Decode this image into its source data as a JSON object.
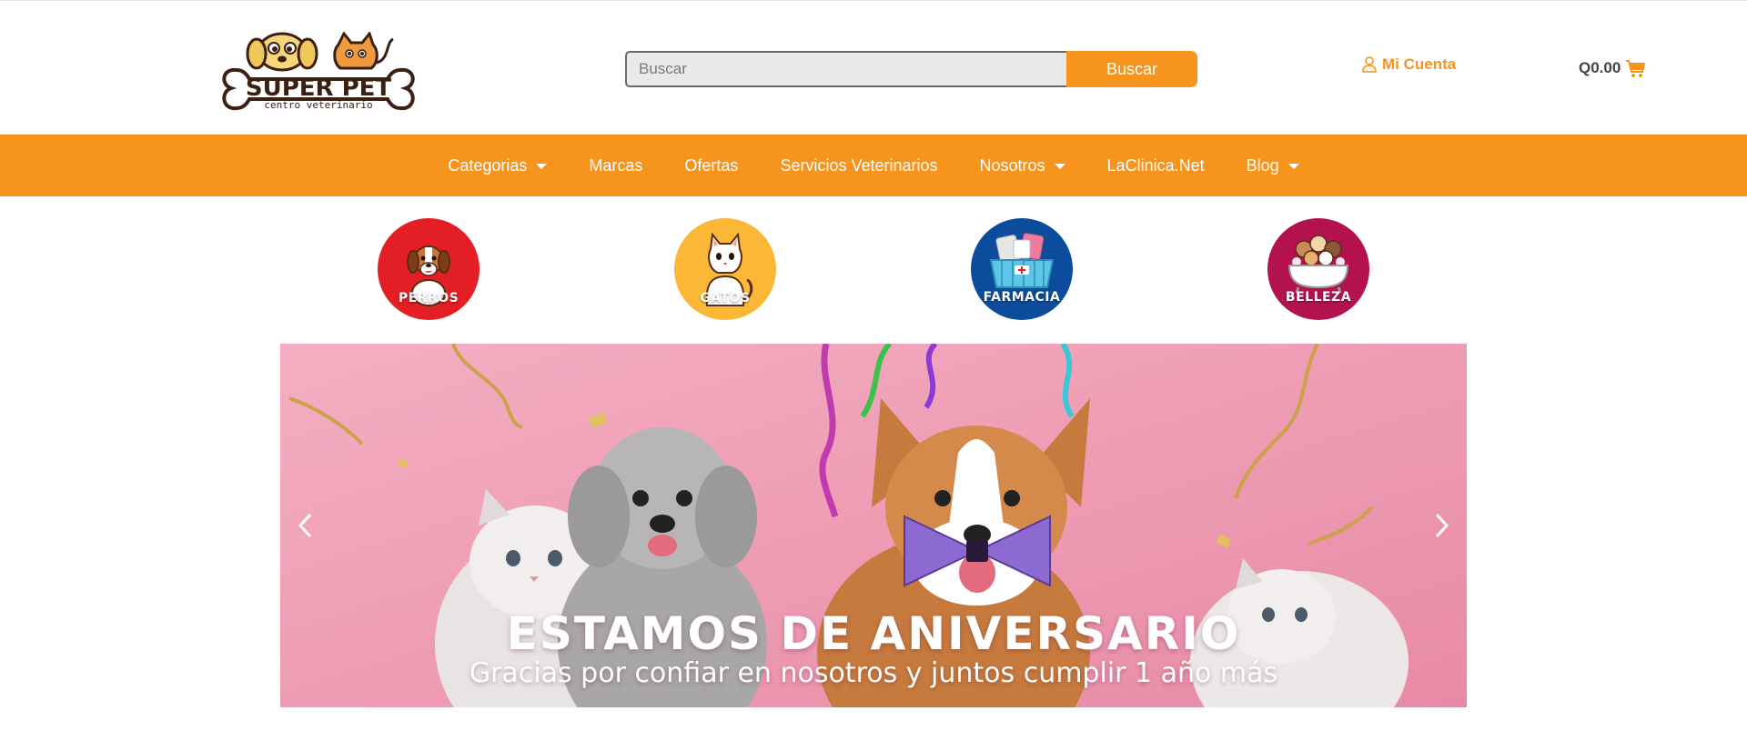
{
  "header": {
    "logo": {
      "brand": "SUPER PET",
      "tagline": "centro veterinario"
    },
    "search": {
      "placeholder": "Buscar",
      "button_label": "Buscar"
    },
    "account": {
      "label": "Mi Cuenta",
      "icon": "user-icon"
    },
    "cart": {
      "total": "Q0.00",
      "icon": "cart-icon"
    }
  },
  "nav": {
    "items": [
      {
        "label": "Categorias",
        "has_dropdown": true
      },
      {
        "label": "Marcas",
        "has_dropdown": false
      },
      {
        "label": "Ofertas",
        "has_dropdown": false
      },
      {
        "label": "Servicios Veterinarios",
        "has_dropdown": false
      },
      {
        "label": "Nosotros",
        "has_dropdown": true
      },
      {
        "label": "LaClinica.Net",
        "has_dropdown": false
      },
      {
        "label": "Blog",
        "has_dropdown": true
      }
    ]
  },
  "categories": [
    {
      "label": "PERROS",
      "color": "#e31e24",
      "icon": "dog-icon"
    },
    {
      "label": "GATOS",
      "color": "#fbb735",
      "icon": "cat-icon"
    },
    {
      "label": "FARMACIA",
      "color": "#0b4d9c",
      "icon": "pharmacy-basket-icon"
    },
    {
      "label": "BELLEZA",
      "color": "#b3124f",
      "icon": "bathtub-pets-icon"
    }
  ],
  "banner": {
    "title": "ESTAMOS DE ANIVERSARIO",
    "subtitle": "Gracias por confiar en nosotros y juntos cumplir 1 año más",
    "prev_icon": "chevron-left-icon",
    "next_icon": "chevron-right-icon"
  },
  "colors": {
    "accent": "#f7941d",
    "banner_bg": "#ee9fb6",
    "logo_dark": "#3a1f12"
  }
}
